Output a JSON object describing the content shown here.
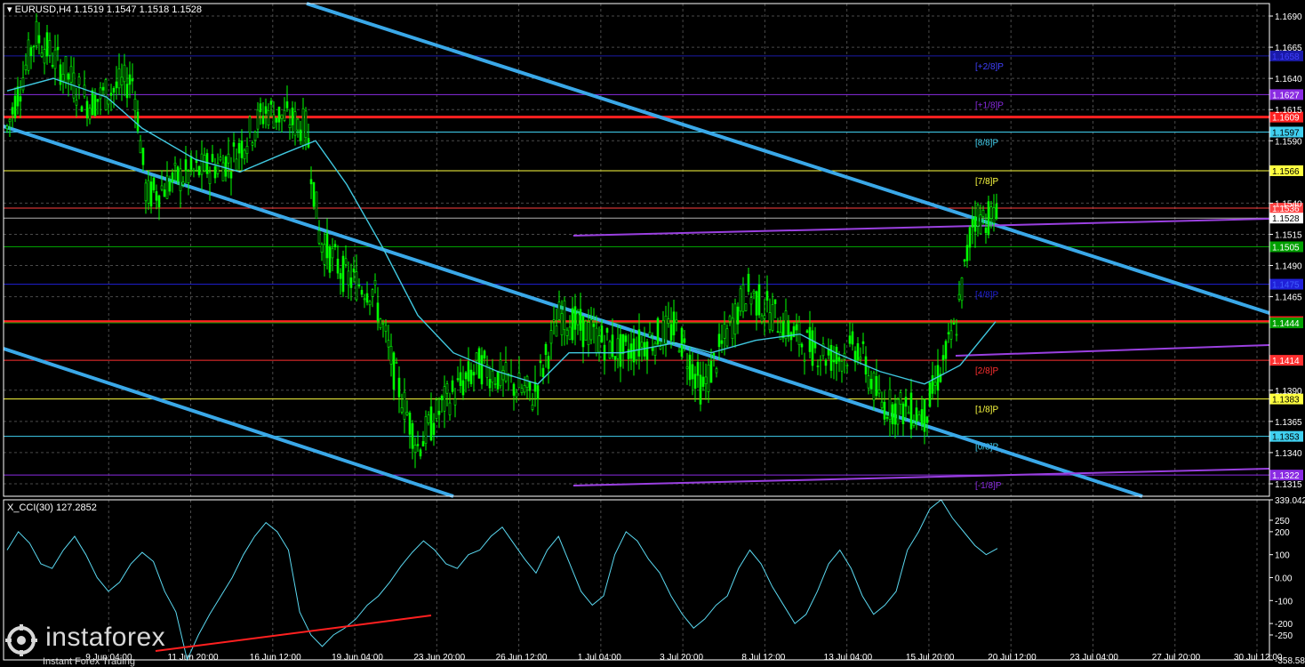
{
  "header": {
    "symbol": "EURUSD,H4",
    "ohlc": "1.1519 1.1547 1.1518 1.1528"
  },
  "colors": {
    "background": "#000000",
    "candle_up": "#00ff00",
    "candle_down": "#00ff00",
    "ma": "#40c8e0",
    "channel": "#3aa8e8",
    "strong_level": "#ff2020",
    "cci_line": "#5ad8f0",
    "price_tag_current": "#ffffff"
  },
  "indicator": {
    "label": "X_CCI(30) 127.2852"
  },
  "watermark": {
    "brand": "instaforex",
    "tagline": "Instant Forex Trading"
  },
  "chart_data": {
    "type": "candlestick",
    "symbol": "EURUSD",
    "timeframe": "H4",
    "ylim": [
      1.1305,
      1.17
    ],
    "price_ticks": [
      "1.1690",
      "1.1665",
      "1.1640",
      "1.1615",
      "1.1590",
      "1.1540",
      "1.1515",
      "1.1490",
      "1.1465",
      "1.1390",
      "1.1365",
      "1.1340",
      "1.1315"
    ],
    "x_ticks": [
      "9 Jun 04:00",
      "11 Jun 20:00",
      "16 Jun 12:00",
      "19 Jun 04:00",
      "23 Jun 20:00",
      "26 Jun 12:00",
      "1 Jul 04:00",
      "3 Jul 20:00",
      "8 Jul 12:00",
      "13 Jul 04:00",
      "15 Jul 20:00",
      "20 Jul 12:00",
      "23 Jul 04:00",
      "27 Jul 20:00",
      "30 Jul 12:00"
    ],
    "levels": [
      {
        "label": "[+2/8]P",
        "price": 1.1658,
        "tag": "1.1658",
        "color": "#1a1aa8",
        "tag_text": "#4040ff"
      },
      {
        "label": "[+1/8]P",
        "price": 1.1627,
        "tag": "1.1627",
        "color": "#8a2be2",
        "tag_text": "#ffffff"
      },
      {
        "label": "",
        "price": 1.1609,
        "tag": "1.1609",
        "color": "#ff2020",
        "tag_text": "#ffffff",
        "strong": true
      },
      {
        "label": "[8/8]P",
        "price": 1.1597,
        "tag": "1.1597",
        "color": "#40d0f0",
        "tag_text": "#000000"
      },
      {
        "label": "[7/8]P",
        "price": 1.1566,
        "tag": "1.1566",
        "color": "#ffff40",
        "tag_text": "#000000"
      },
      {
        "label": "",
        "price": 1.1536,
        "tag": "1.1536",
        "color": "#ff4040",
        "tag_text": "#ffffff"
      },
      {
        "label": "",
        "price": 1.1505,
        "tag": "1.1505",
        "color": "#00a000",
        "tag_text": "#ffffff"
      },
      {
        "label": "[4/8]P",
        "price": 1.1475,
        "tag": "1.1475",
        "color": "#2020d8",
        "tag_text": "#4060ff"
      },
      {
        "label": "",
        "price": 1.1445,
        "tag": "1.1445",
        "color": "#ff2020",
        "tag_text": "#ffffff",
        "strong": true
      },
      {
        "label": "",
        "price": 1.1444,
        "tag": "1.1444",
        "color": "#00a000",
        "tag_text": "#ffffff"
      },
      {
        "label": "[2/8]P",
        "price": 1.1414,
        "tag": "1.1414",
        "color": "#ff3030",
        "tag_text": "#ffffff"
      },
      {
        "label": "[1/8]P",
        "price": 1.1383,
        "tag": "1.1383",
        "color": "#ffff40",
        "tag_text": "#000000"
      },
      {
        "label": "[0/8]P",
        "price": 1.1353,
        "tag": "1.1353",
        "color": "#40d0f0",
        "tag_text": "#000000"
      },
      {
        "label": "[-1/8]P",
        "price": 1.1322,
        "tag": "1.1322",
        "color": "#8a2be2",
        "tag_text": "#ffffff"
      }
    ],
    "current_price": {
      "price": 1.1528,
      "tag": "1.1528"
    },
    "cci": {
      "ylim": [
        -358.585,
        339.0424
      ],
      "ticks": [
        "339.0424",
        "250",
        "200",
        "100",
        "0.00",
        "-100",
        "-200",
        "-250",
        "-358.585"
      ],
      "values": [
        120,
        200,
        150,
        60,
        40,
        120,
        180,
        100,
        0,
        -60,
        -20,
        60,
        110,
        70,
        -60,
        -150,
        -358,
        -250,
        -160,
        -80,
        0,
        100,
        180,
        240,
        200,
        120,
        -150,
        -250,
        -300,
        -250,
        -220,
        -180,
        -120,
        -80,
        -20,
        50,
        110,
        160,
        120,
        60,
        40,
        100,
        120,
        180,
        220,
        150,
        80,
        20,
        120,
        180,
        60,
        -60,
        -120,
        -80,
        100,
        200,
        160,
        80,
        20,
        -80,
        -160,
        -220,
        -180,
        -120,
        -80,
        40,
        120,
        60,
        -40,
        -120,
        -200,
        -160,
        -60,
        60,
        120,
        40,
        -80,
        -160,
        -120,
        -60,
        120,
        200,
        300,
        339,
        260,
        200,
        140,
        100,
        127
      ]
    }
  }
}
